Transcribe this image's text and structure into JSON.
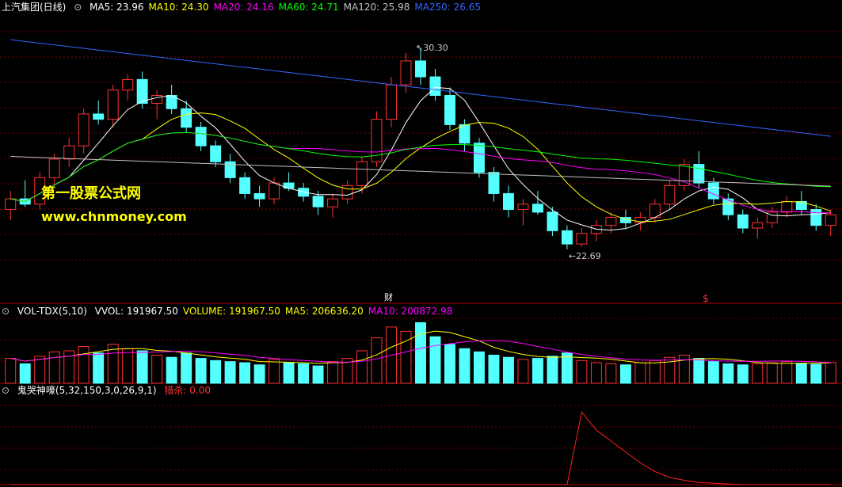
{
  "main_panel": {
    "title": "上汽集团(日线)",
    "icon": "circle-toggle-icon",
    "indicators": [
      {
        "label": "MA5: 23.96",
        "color": "#ffffff"
      },
      {
        "label": "MA10: 24.30",
        "color": "#ffff00"
      },
      {
        "label": "MA20: 24.16",
        "color": "#ff00ff"
      },
      {
        "label": "MA60: 24.71",
        "color": "#00ff00"
      },
      {
        "label": "MA120: 25.98",
        "color": "#c0c0c0"
      },
      {
        "label": "MA250: 26.65",
        "color": "#3366ff"
      }
    ],
    "high_label": "30.30",
    "low_label": "22.69",
    "marker_cai": "财",
    "marker_s": "$"
  },
  "volume_panel": {
    "title": "VOL-TDX(5,10)",
    "icon": "circle-toggle-icon",
    "indicators": [
      {
        "label": "VVOL: 191967.50",
        "color": "#ffffff"
      },
      {
        "label": "VOLUME: 191967.50",
        "color": "#ffff00"
      },
      {
        "label": "MA5: 206636.20",
        "color": "#ffff00"
      },
      {
        "label": "MA10: 200872.98",
        "color": "#ff00ff"
      }
    ]
  },
  "indicator_panel": {
    "title": "鬼哭神嚎(5,32,150,3,0,26,9,1)",
    "icon": "circle-toggle-icon",
    "value_label": "猎杀: 0.00",
    "value_color": "#ff3333"
  },
  "watermark": {
    "line1": "第一股票公式网",
    "line2": "www.chnmoney.com"
  },
  "colors": {
    "up": "#ff3232",
    "down": "#54ffff",
    "ma5": "#ffffff",
    "ma10": "#ffff00",
    "ma20": "#ff00ff",
    "ma60": "#00ff00",
    "ma120": "#c0c0c0",
    "ma250": "#3366ff",
    "grid": "#7a0000"
  },
  "chart_data": [
    {
      "type": "candlestick",
      "panel": "price",
      "ylim": [
        21.5,
        31.5
      ],
      "candles": [
        [
          24.2,
          24.9,
          23.8,
          24.6
        ],
        [
          24.6,
          25.3,
          24.3,
          24.4
        ],
        [
          24.4,
          25.6,
          24.2,
          25.4
        ],
        [
          25.4,
          26.3,
          25.1,
          26.1
        ],
        [
          26.1,
          26.9,
          25.8,
          26.6
        ],
        [
          26.6,
          28.0,
          26.3,
          27.8
        ],
        [
          27.8,
          28.3,
          27.4,
          27.6
        ],
        [
          27.6,
          28.9,
          27.3,
          28.7
        ],
        [
          28.7,
          29.3,
          28.3,
          29.1
        ],
        [
          29.1,
          29.4,
          28.0,
          28.2
        ],
        [
          28.2,
          28.7,
          27.6,
          28.5
        ],
        [
          28.5,
          28.9,
          27.8,
          28.0
        ],
        [
          28.0,
          28.3,
          27.1,
          27.3
        ],
        [
          27.3,
          27.5,
          26.4,
          26.6
        ],
        [
          26.6,
          26.8,
          25.8,
          26.0
        ],
        [
          26.0,
          26.3,
          25.2,
          25.4
        ],
        [
          25.4,
          25.6,
          24.6,
          24.8
        ],
        [
          24.8,
          25.1,
          24.3,
          24.6
        ],
        [
          24.6,
          25.4,
          24.4,
          25.2
        ],
        [
          25.2,
          25.6,
          24.9,
          25.0
        ],
        [
          25.0,
          25.2,
          24.5,
          24.7
        ],
        [
          24.7,
          24.9,
          24.0,
          24.3
        ],
        [
          24.3,
          24.8,
          23.9,
          24.6
        ],
        [
          24.6,
          25.3,
          24.4,
          25.1
        ],
        [
          25.1,
          26.2,
          24.8,
          26.0
        ],
        [
          26.0,
          27.9,
          25.8,
          27.6
        ],
        [
          27.6,
          29.2,
          27.3,
          28.9
        ],
        [
          28.9,
          30.1,
          28.6,
          29.8
        ],
        [
          29.8,
          30.3,
          28.9,
          29.2
        ],
        [
          29.2,
          29.5,
          28.3,
          28.5
        ],
        [
          28.5,
          28.8,
          27.2,
          27.4
        ],
        [
          27.4,
          27.6,
          26.4,
          26.7
        ],
        [
          26.7,
          26.9,
          25.4,
          25.6
        ],
        [
          25.6,
          25.8,
          24.5,
          24.8
        ],
        [
          24.8,
          25.1,
          23.9,
          24.2
        ],
        [
          24.2,
          24.6,
          23.6,
          24.4
        ],
        [
          24.4,
          24.9,
          24.0,
          24.1
        ],
        [
          24.1,
          24.3,
          23.2,
          23.4
        ],
        [
          23.4,
          23.6,
          22.7,
          22.9
        ],
        [
          22.9,
          23.5,
          22.8,
          23.3
        ],
        [
          23.3,
          23.8,
          23.0,
          23.6
        ],
        [
          23.6,
          24.1,
          23.3,
          23.9
        ],
        [
          23.9,
          24.2,
          23.5,
          23.7
        ],
        [
          23.7,
          24.1,
          23.4,
          23.9
        ],
        [
          23.9,
          24.6,
          23.7,
          24.4
        ],
        [
          24.4,
          25.3,
          24.2,
          25.1
        ],
        [
          25.1,
          26.1,
          24.9,
          25.9
        ],
        [
          25.9,
          26.4,
          25.0,
          25.2
        ],
        [
          25.2,
          25.4,
          24.4,
          24.6
        ],
        [
          24.6,
          24.8,
          23.8,
          24.0
        ],
        [
          24.0,
          24.2,
          23.3,
          23.5
        ],
        [
          23.5,
          23.9,
          23.1,
          23.7
        ],
        [
          23.7,
          24.3,
          23.5,
          24.1
        ],
        [
          24.1,
          24.7,
          23.9,
          24.5
        ],
        [
          24.5,
          24.9,
          24.0,
          24.2
        ],
        [
          24.2,
          24.4,
          23.4,
          23.6
        ],
        [
          23.6,
          24.2,
          23.2,
          24.0
        ]
      ]
    },
    {
      "type": "bar",
      "panel": "volume",
      "ylim": [
        0,
        600000
      ],
      "values": [
        230000,
        180000,
        250000,
        290000,
        300000,
        340000,
        280000,
        360000,
        320000,
        300000,
        260000,
        240000,
        280000,
        230000,
        210000,
        200000,
        190000,
        170000,
        220000,
        190000,
        180000,
        160000,
        200000,
        230000,
        300000,
        420000,
        520000,
        480000,
        560000,
        430000,
        360000,
        320000,
        290000,
        260000,
        240000,
        220000,
        230000,
        250000,
        280000,
        210000,
        190000,
        180000,
        170000,
        190000,
        210000,
        240000,
        260000,
        230000,
        200000,
        180000,
        170000,
        180000,
        190000,
        200000,
        185000,
        175000,
        191967
      ]
    },
    {
      "type": "line",
      "panel": "indicator",
      "name": "猎杀",
      "ylim": [
        0,
        120
      ],
      "values": [
        0,
        0,
        0,
        0,
        0,
        0,
        0,
        0,
        0,
        0,
        0,
        0,
        0,
        0,
        0,
        0,
        0,
        0,
        0,
        0,
        0,
        0,
        0,
        0,
        0,
        0,
        0,
        0,
        0,
        0,
        0,
        0,
        0,
        0,
        0,
        0,
        0,
        0,
        0,
        100,
        75,
        60,
        45,
        30,
        18,
        10,
        6,
        3,
        2,
        1,
        0,
        0,
        0,
        0,
        0,
        0,
        0
      ]
    }
  ]
}
